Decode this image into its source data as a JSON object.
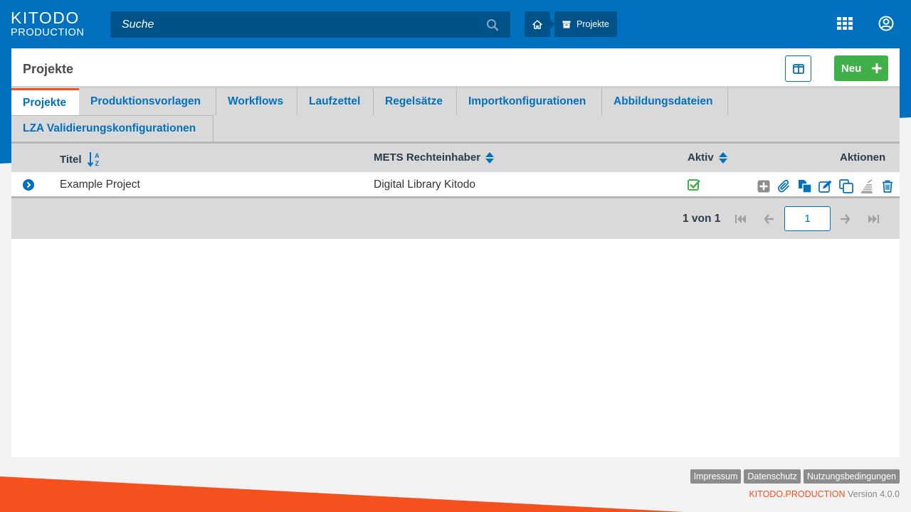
{
  "header": {
    "logo_top": "KITODO",
    "logo_bottom": "PRODUCTION",
    "search_placeholder": "Suche",
    "breadcrumb": {
      "current": "Projekte"
    }
  },
  "page": {
    "title": "Projekte",
    "new_button": "Neu"
  },
  "tabs": [
    {
      "label": "Projekte",
      "active": true
    },
    {
      "label": "Produktionsvorlagen"
    },
    {
      "label": "Workflows"
    },
    {
      "label": "Laufzettel"
    },
    {
      "label": "Regelsätze"
    },
    {
      "label": "Importkonfigurationen"
    },
    {
      "label": "Abbildungsdateien"
    },
    {
      "label": "LZA Validierungskonfigurationen"
    }
  ],
  "table": {
    "columns": {
      "title": "Titel",
      "owner": "METS Rechteinhaber",
      "active": "Aktiv",
      "actions": "Aktionen"
    },
    "rows": [
      {
        "title": "Example Project",
        "owner": "Digital Library Kitodo",
        "active": true
      }
    ]
  },
  "pagination": {
    "summary": "1 von 1",
    "current_page": "1"
  },
  "footer": {
    "links": [
      "Impressum",
      "Datenschutz",
      "Nutzungsbedingungen"
    ],
    "brand": "KITODO.PRODUCTION",
    "version": "Version 4.0.0"
  },
  "colors": {
    "primary": "#0070bf",
    "accent": "#f4511e",
    "success": "#40b14a"
  },
  "icons": {
    "search": "search-icon",
    "home": "home-icon",
    "projects": "box-icon",
    "apps": "grid-icon",
    "user": "user-circle-icon"
  }
}
